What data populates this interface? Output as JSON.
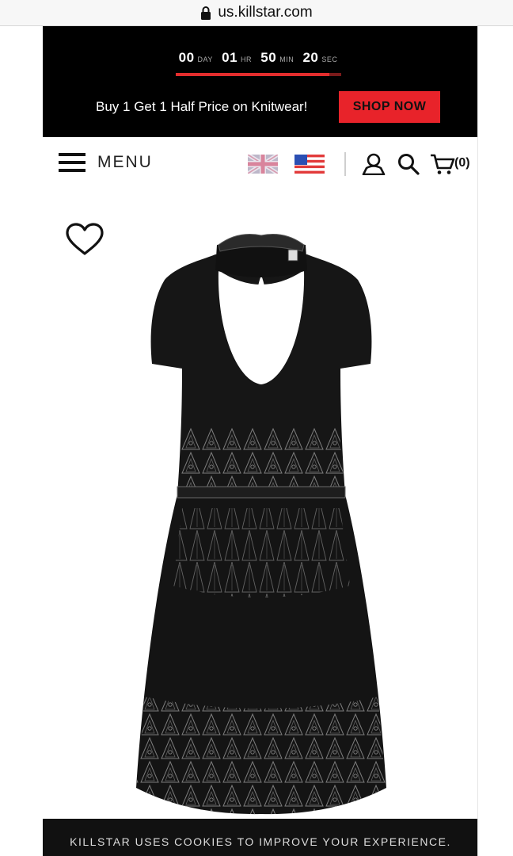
{
  "browser": {
    "url": "us.killstar.com"
  },
  "countdown": {
    "days": "00",
    "days_label": "DAY",
    "hours": "01",
    "hours_label": "HR",
    "minutes": "50",
    "minutes_label": "MIN",
    "seconds": "20",
    "seconds_label": "SEC",
    "progress": 0.93
  },
  "promo": {
    "text": "Buy 1 Get 1 Half Price on Knitwear!",
    "button_label": "SHOP NOW"
  },
  "nav": {
    "menu_label": "MENU",
    "cart_count": "(0)",
    "icons": [
      "hamburger-icon",
      "uk-flag-icon",
      "us-flag-icon",
      "user-icon",
      "search-icon",
      "cart-icon"
    ]
  },
  "product": {
    "wishlist_icon": "heart-icon",
    "image": "black-dress-image"
  },
  "cookie_banner": {
    "text": "KILLSTAR USES COOKIES TO IMPROVE YOUR EXPERIENCE."
  },
  "colors": {
    "promo_bg": "#000000",
    "accent_red": "#e8232a",
    "cookie_bg": "#111111"
  }
}
